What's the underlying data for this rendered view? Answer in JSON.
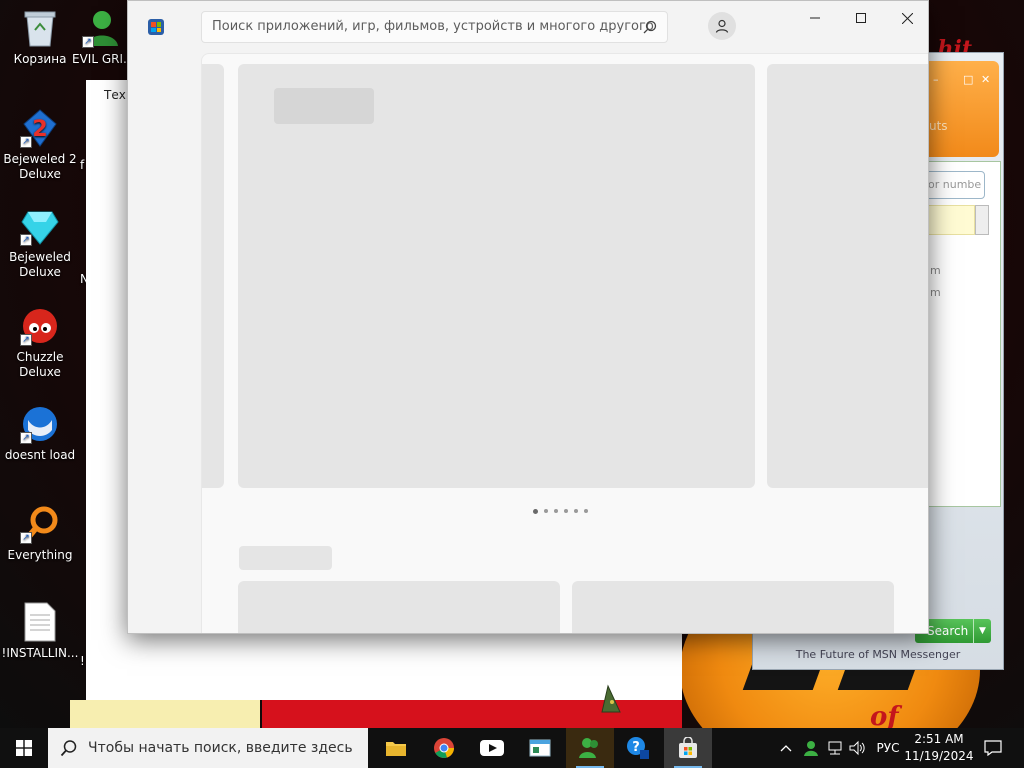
{
  "desktop": {
    "icons": [
      {
        "label": "Корзина"
      },
      {
        "label": "EVIL GRI..."
      },
      {
        "label": "Bejeweled 2 Deluxe"
      },
      {
        "label": "Bejeweled Deluxe"
      },
      {
        "label": "Chuzzle Deluxe"
      },
      {
        "label": "doesnt load"
      },
      {
        "label": "Everything"
      },
      {
        "label": "!INSTALLIN..."
      }
    ],
    "fragments": {
      "f": "f",
      "n": "N",
      "excl": "!"
    }
  },
  "back_window": {
    "label": "Техн"
  },
  "msn": {
    "input_placeholder": "or numbe",
    "search_button": "Search",
    "footer": "The Future of MSN Messenger",
    "list_fragments": [
      "m",
      "m"
    ],
    "orange_fragments": [
      "uts"
    ]
  },
  "store": {
    "search_placeholder": "Поиск приложений, игр, фильмов, устройств и многого другого",
    "carousel_dots": 6,
    "active_dot": 0
  },
  "taskbar": {
    "search_placeholder": "Чтобы начать поиск, введите здесь",
    "language": "РУС",
    "time": "2:51 AM",
    "date": "11/19/2024"
  },
  "wallpaper": {
    "text_top": "hit",
    "text_bottom": "of"
  },
  "colors": {
    "accent": "#0078d4",
    "msn_orange": "#f28a1a",
    "msn_green": "#2f9a33"
  }
}
